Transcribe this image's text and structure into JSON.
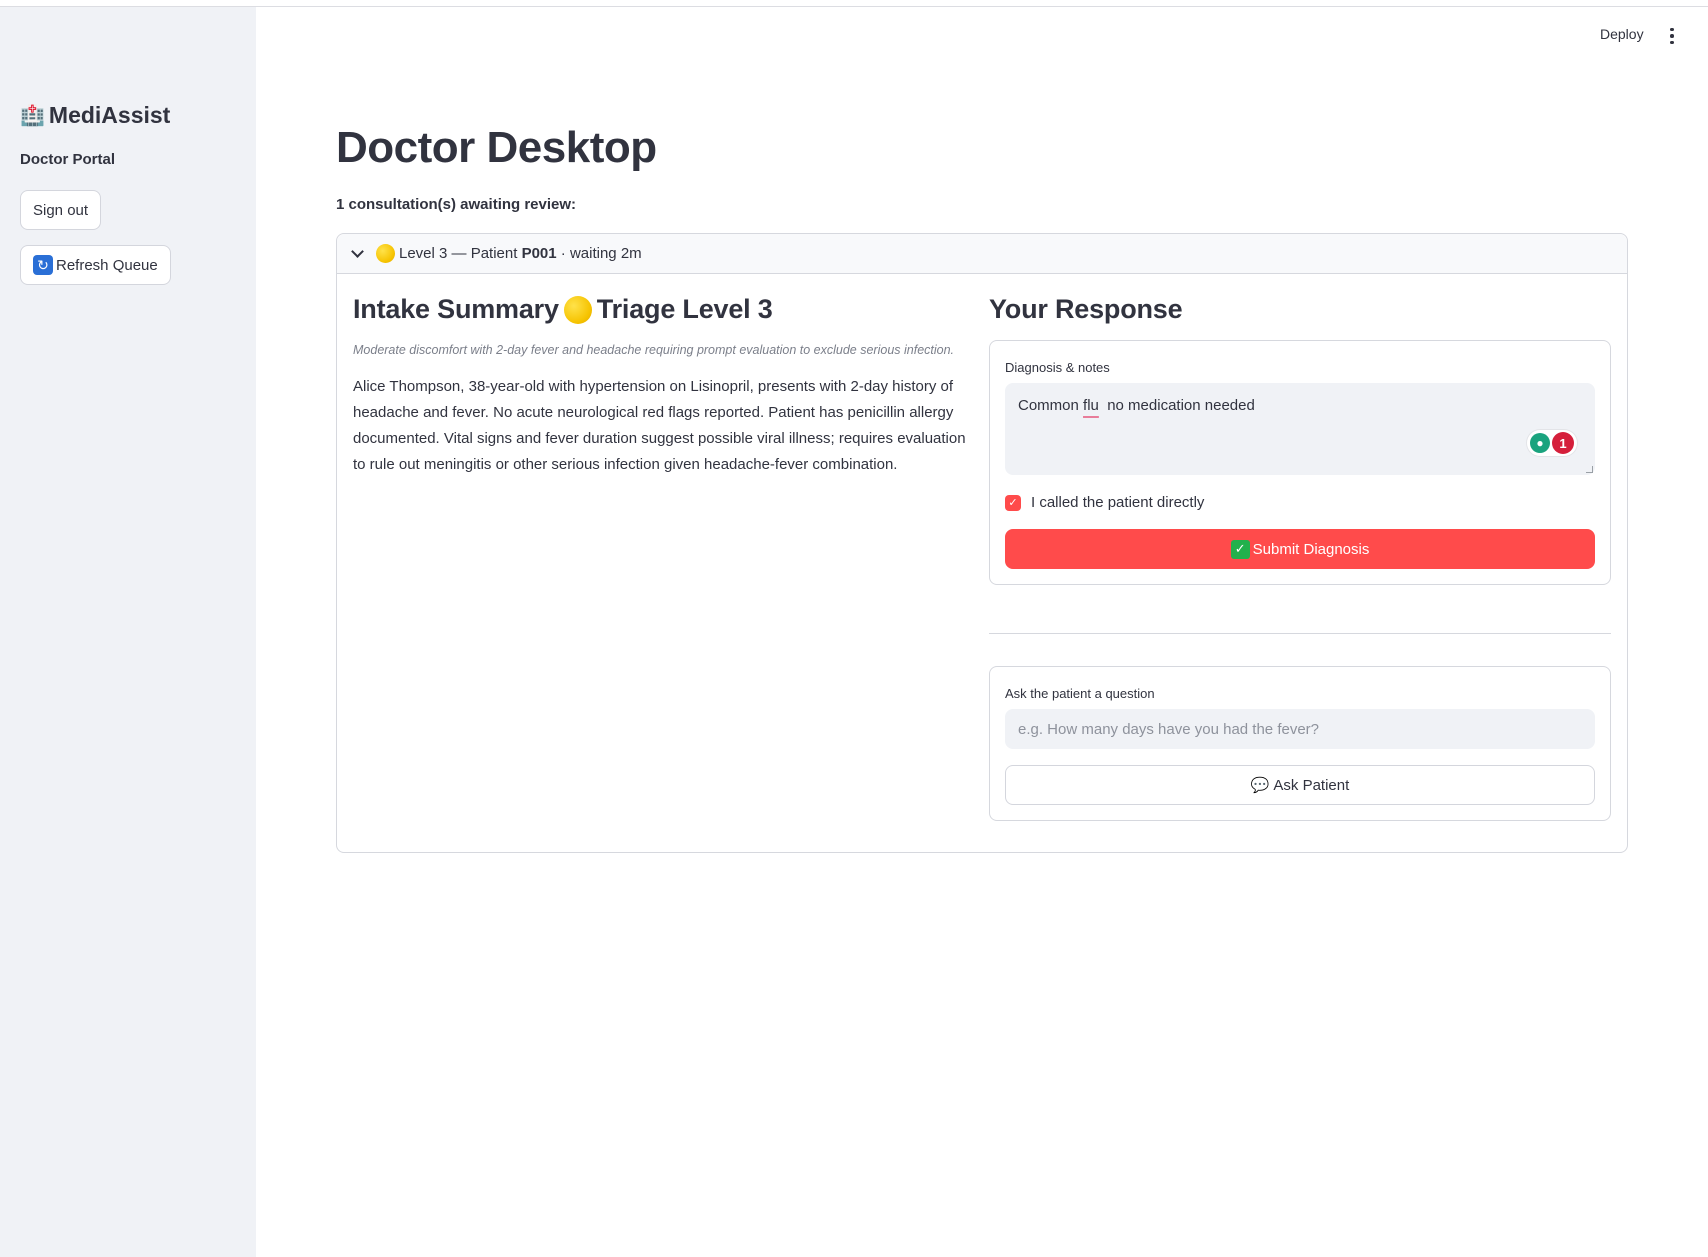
{
  "sidebar": {
    "brand_icon": "hospital-icon",
    "brand_name": "MediAssist",
    "portal_label": "Doctor Portal",
    "sign_out_label": "Sign out",
    "refresh_icon": "refresh-icon",
    "refresh_label": "Refresh Queue"
  },
  "toolbar": {
    "deploy_label": "Deploy",
    "menu_icon": "kebab-menu-icon"
  },
  "main": {
    "title": "Doctor Desktop",
    "awaiting_text": "1 consultation(s) awaiting review:"
  },
  "consultation": {
    "header": {
      "level_text": "Level 3 — Patient",
      "patient_id": "P001",
      "waiting_text": "· waiting 2m"
    },
    "intake": {
      "heading_prefix": "Intake Summary",
      "heading_suffix": "Triage Level 3",
      "caption": "Moderate discomfort with 2-day fever and headache requiring prompt evaluation to exclude serious infection.",
      "summary": "Alice Thompson, 38-year-old with hypertension on Lisinopril, presents with 2-day history of headache and fever. No acute neurological red flags reported. Patient has penicillin allergy documented. Vital signs and fever duration suggest possible viral illness; requires evaluation to rule out meningitis or other serious infection given headache-fever combination."
    },
    "response": {
      "heading": "Your Response",
      "diagnosis_label": "Diagnosis & notes",
      "diagnosis_value_part1": "Common ",
      "diagnosis_value_flagged": "flu",
      "diagnosis_value_part2": "  no medication needed",
      "grammar_badge_count": "1",
      "called_checkbox_label": "I called the patient directly",
      "called_checked": true,
      "submit_label": "Submit Diagnosis",
      "ask_label": "Ask the patient a question",
      "ask_placeholder": "e.g. How many days have you had the fever?",
      "ask_button_label": "Ask Patient"
    }
  },
  "colors": {
    "primary": "#ff4b4b",
    "sidebar_bg": "#f0f2f6",
    "text": "#31333f",
    "triage_yellow": "#f6c300"
  }
}
